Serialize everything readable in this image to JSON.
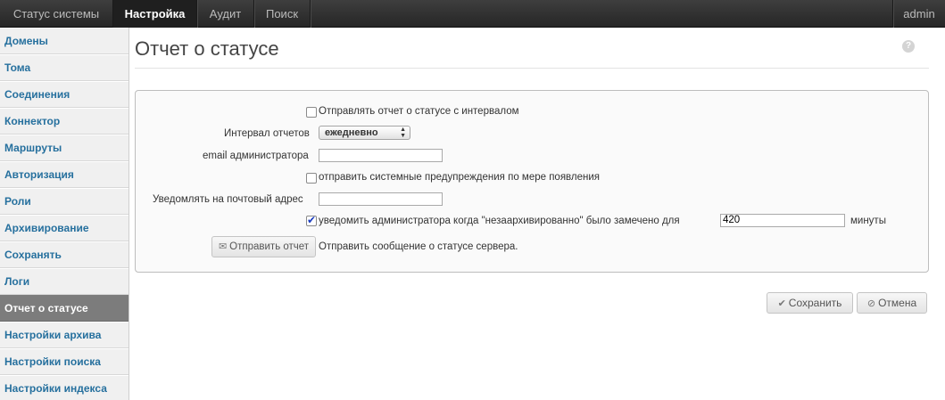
{
  "nav": {
    "tabs": [
      {
        "label": "Статус системы"
      },
      {
        "label": "Настройка"
      },
      {
        "label": "Аудит"
      },
      {
        "label": "Поиск"
      }
    ],
    "user": "admin"
  },
  "sidebar": {
    "items": [
      {
        "label": "Домены"
      },
      {
        "label": "Тома"
      },
      {
        "label": "Соединения"
      },
      {
        "label": "Коннектор"
      },
      {
        "label": "Маршруты"
      },
      {
        "label": "Авторизация"
      },
      {
        "label": "Роли"
      },
      {
        "label": "Архивирование"
      },
      {
        "label": "Сохранять"
      },
      {
        "label": "Логи"
      },
      {
        "label": "Отчет о статусе"
      },
      {
        "label": "Настройки архива"
      },
      {
        "label": "Настройки поиска"
      },
      {
        "label": "Настройки индекса"
      }
    ],
    "active": "Отчет о статусе"
  },
  "page": {
    "title": "Отчет о статусе",
    "help_icon": "question-icon"
  },
  "form": {
    "send_interval_label": "Отправлять отчет о статусе с интервалом",
    "send_interval_checked": false,
    "interval_label": "Интервал отчетов",
    "interval_value": "ежедневно",
    "admin_email_label": "email администратора",
    "admin_email_value": "",
    "send_warnings_label": "отправить системные предупреждения по мере появления",
    "send_warnings_checked": false,
    "notify_email_label": "Уведомлять на почтовый адрес",
    "notify_email_value": "",
    "notify_admin_label": "уведомить администратора когда \"незаархивированно\" было замечено для",
    "notify_admin_checked": true,
    "notify_minutes_value": "420",
    "minutes_label": "минуты",
    "send_report_button": "Отправить отчет",
    "send_report_desc": "Отправить сообщение о статусе сервера."
  },
  "actions": {
    "save": "Сохранить",
    "cancel": "Отмена"
  }
}
